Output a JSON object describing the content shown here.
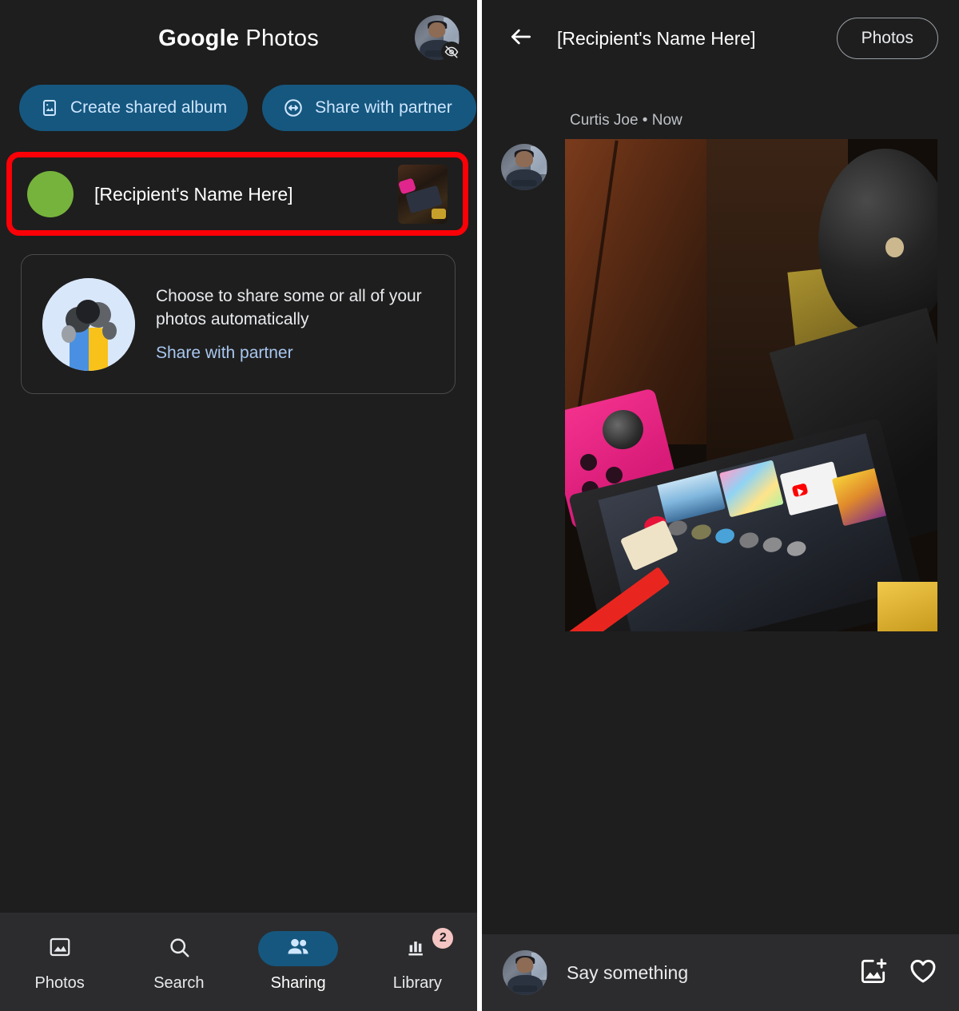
{
  "left": {
    "header": {
      "title_bold": "Google",
      "title_light": " Photos",
      "avatar_name": "account-avatar",
      "avatar_badge_icon": "eye-off-icon"
    },
    "chips": [
      {
        "label": "Create shared album",
        "icon": "photo-album-icon"
      },
      {
        "label": "Share with partner",
        "icon": "partner-share-icon"
      }
    ],
    "recipient": {
      "name": "[Recipient's Name Here]",
      "avatar_color": "#76b33c",
      "thumbnail_name": "nintendo-switch-photo-thumbnail",
      "highlight_color": "#fb0007"
    },
    "partner_card": {
      "description": "Choose to share some or all of your photos automatically",
      "link_label": "Share with partner",
      "illustration": "two-people-illustration"
    },
    "nav": {
      "items": [
        {
          "label": "Photos",
          "icon": "photo-icon",
          "active": false,
          "badge": ""
        },
        {
          "label": "Search",
          "icon": "search-icon",
          "active": false,
          "badge": ""
        },
        {
          "label": "Sharing",
          "icon": "people-icon",
          "active": true,
          "badge": ""
        },
        {
          "label": "Library",
          "icon": "library-icon",
          "active": false,
          "badge": "2"
        }
      ],
      "active_pill_color": "#15577f",
      "badge_color": "#f4c5c2"
    }
  },
  "right": {
    "header": {
      "back_icon": "arrow-left-icon",
      "title": "[Recipient's Name Here]",
      "pill_label": "Photos"
    },
    "post": {
      "meta": "Curtis Joe • Now",
      "author": "Curtis Joe",
      "time": "Now",
      "avatar_name": "curtis-joe-avatar",
      "photo_name": "nintendo-switch-photo"
    },
    "composer": {
      "placeholder": "Say something",
      "avatar_name": "composer-avatar",
      "add_photo_icon": "add-photo-icon",
      "heart_icon": "heart-icon"
    }
  },
  "colors": {
    "background": "#1e1e1e",
    "surface": "#2c2c2e",
    "accent_blue": "#15577f",
    "accent_text": "#cfe6ff",
    "divider": "#ffffff"
  }
}
